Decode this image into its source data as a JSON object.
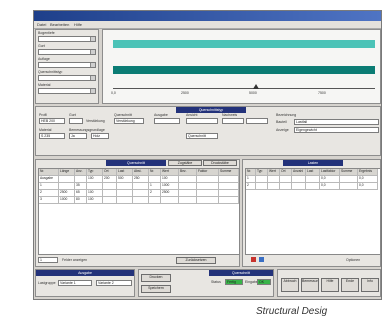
{
  "menu": [
    "Datei",
    "Bearbeiten",
    "Hilfe"
  ],
  "top_panel": {
    "fields": [
      "Bogentiefe",
      "Gurt",
      "Auflage",
      "Querschnittstyp",
      "Material"
    ],
    "scale_labels": [
      "0,0",
      "2500",
      "5000",
      "7500"
    ]
  },
  "mid_panel": {
    "header": "Querschnittstyp",
    "labels": [
      "Profil",
      "Gurt",
      "Verstärkung",
      "Querschnitt",
      "Material",
      "Bemessungsgrundlage",
      "Ausgabe",
      "Ansicht",
      "Nachweis",
      "Bezeichnung",
      "Bauteil",
      "Anzeige"
    ],
    "values": [
      "HEB 200",
      "Verstärkung",
      "S 235",
      "Ja",
      "Holz",
      "Lastfall",
      "Querschnitt",
      "Eigengewicht"
    ]
  },
  "left_table": {
    "header": "Querschnitt",
    "tabs": [
      "Zugstäbe",
      "Druckstäbe"
    ],
    "columns": [
      "Nr.",
      "Länge",
      "Anz.",
      "Typ",
      "Ort",
      "Last",
      "Abst.",
      "Nr.",
      "Wert",
      "Bez.",
      "Faktor",
      "Summe"
    ],
    "rows": [
      [
        "Ausgabe",
        "",
        "",
        "100",
        "200",
        "500",
        "250",
        "",
        "100",
        "",
        "",
        ""
      ],
      [
        "1",
        "",
        "35",
        "",
        "",
        "",
        "",
        "1",
        "1000",
        "",
        "",
        ""
      ],
      [
        "2",
        "2500",
        "65",
        "100",
        "",
        "",
        "",
        "2",
        "2500",
        "",
        "",
        ""
      ],
      [
        "3",
        "1000",
        "80",
        "100",
        "",
        "",
        "",
        "",
        "",
        "",
        "",
        ""
      ]
    ],
    "footer_field": "1",
    "footer_label": "Felder anzeigen",
    "footer_button": "Zurücksetzen"
  },
  "right_table": {
    "header": "Lasten",
    "columns": [
      "Nr.",
      "Typ",
      "Wert",
      "Ort",
      "Anzahl",
      "Last",
      "Lastfaktor",
      "Summe",
      "Ergebnis"
    ],
    "rows": [
      [
        "1",
        "",
        "",
        "",
        "",
        "",
        "0,0",
        "",
        "0,0"
      ],
      [
        "2",
        "",
        "",
        "",
        "",
        "",
        "0,0",
        "",
        "0,0"
      ]
    ],
    "footer_label": "Optionen"
  },
  "bottom": {
    "left_head": "Ausgabe",
    "left_label": "Lastgruppe",
    "left_field": "Variante 1",
    "left_field2": "Variante 2",
    "mid_head": "Querschnitt",
    "mid_btns": [
      "Drucken",
      "Speichern"
    ],
    "green_labels": [
      "Status",
      "Fertig",
      "Eingabe",
      "OK"
    ],
    "right_btns": [
      "Abbruch",
      "Bemessung starten",
      "Hilfe",
      "Ende",
      "Info"
    ]
  },
  "caption": "Structural Desig"
}
